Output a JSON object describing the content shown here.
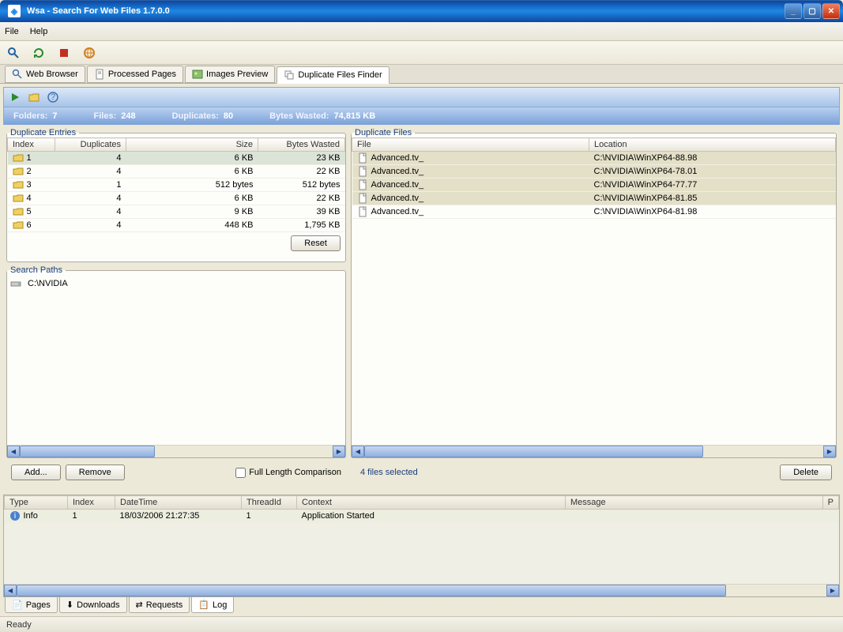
{
  "window": {
    "title": "Wsa - Search For Web Files 1.7.0.0"
  },
  "menu": {
    "file": "File",
    "help": "Help"
  },
  "tabs": {
    "web_browser": "Web Browser",
    "processed_pages": "Processed Pages",
    "images_preview": "Images Preview",
    "duplicate_finder": "Duplicate Files Finder"
  },
  "stats": {
    "folders_k": "Folders:",
    "folders_v": "7",
    "files_k": "Files:",
    "files_v": "248",
    "duplicates_k": "Duplicates:",
    "duplicates_v": "80",
    "bytes_k": "Bytes Wasted:",
    "bytes_v": "74,815 KB"
  },
  "entries": {
    "legend": "Duplicate Entries",
    "headers": {
      "index": "Index",
      "dups": "Duplicates",
      "size": "Size",
      "wasted": "Bytes Wasted"
    },
    "rows": [
      {
        "index": "1",
        "dups": "4",
        "size": "6 KB",
        "wasted": "23 KB"
      },
      {
        "index": "2",
        "dups": "4",
        "size": "6 KB",
        "wasted": "22 KB"
      },
      {
        "index": "3",
        "dups": "1",
        "size": "512 bytes",
        "wasted": "512 bytes"
      },
      {
        "index": "4",
        "dups": "4",
        "size": "6 KB",
        "wasted": "22 KB"
      },
      {
        "index": "5",
        "dups": "4",
        "size": "9 KB",
        "wasted": "39 KB"
      },
      {
        "index": "6",
        "dups": "4",
        "size": "448 KB",
        "wasted": "1,795 KB"
      }
    ],
    "reset": "Reset"
  },
  "paths": {
    "legend": "Search Paths",
    "items": [
      "C:\\NVIDIA"
    ],
    "add": "Add...",
    "remove": "Remove",
    "full_length": "Full Length Comparison"
  },
  "files": {
    "legend": "Duplicate Files",
    "headers": {
      "file": "File",
      "location": "Location"
    },
    "rows": [
      {
        "file": "Advanced.tv_",
        "loc": "C:\\NVIDIA\\WinXP64-88.98"
      },
      {
        "file": "Advanced.tv_",
        "loc": "C:\\NVIDIA\\WinXP64-78.01"
      },
      {
        "file": "Advanced.tv_",
        "loc": "C:\\NVIDIA\\WinXP64-77.77"
      },
      {
        "file": "Advanced.tv_",
        "loc": "C:\\NVIDIA\\WinXP64-81.85"
      },
      {
        "file": "Advanced.tv_",
        "loc": "C:\\NVIDIA\\WinXP64-81.98"
      }
    ],
    "selected": "4 files selected",
    "delete": "Delete"
  },
  "log": {
    "headers": {
      "type": "Type",
      "index": "Index",
      "datetime": "DateTime",
      "threadid": "ThreadId",
      "context": "Context",
      "message": "Message",
      "p": "P"
    },
    "rows": [
      {
        "type": "Info",
        "index": "1",
        "datetime": "18/03/2006 21:27:35",
        "threadid": "1",
        "context": "Application Started",
        "message": ""
      }
    ]
  },
  "bottomTabs": {
    "pages": "Pages",
    "downloads": "Downloads",
    "requests": "Requests",
    "log": "Log"
  },
  "status": {
    "text": "Ready"
  }
}
